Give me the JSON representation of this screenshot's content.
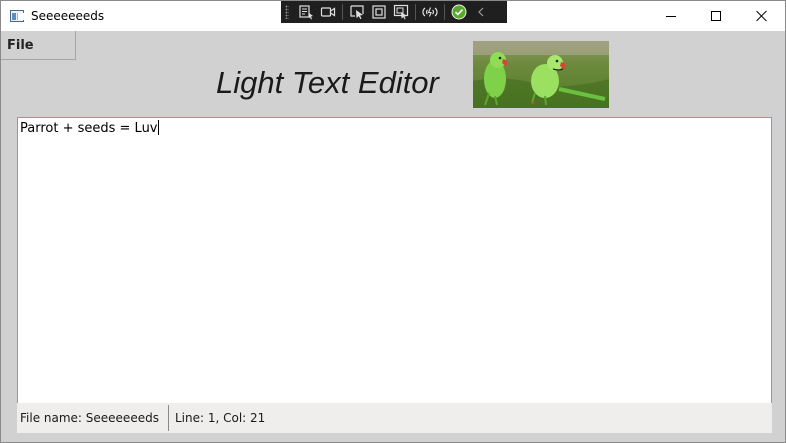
{
  "window": {
    "title": "Seeeeeeeds",
    "controls": {
      "minimize_icon": "minimize-icon",
      "maximize_icon": "maximize-icon",
      "close_icon": "close-icon"
    }
  },
  "debug_toolbar": {
    "icons": [
      "live-visual-tree-icon",
      "record-icon",
      "select-element-icon",
      "display-layout-adorners-icon",
      "track-focus-icon",
      "hot-reload-icon",
      "status-ok-icon",
      "collapse-chevron-icon"
    ],
    "colors": {
      "background": "#1f1f1f",
      "ok": "#4caf50"
    }
  },
  "menu": {
    "file_label": "File"
  },
  "header": {
    "title": "Light Text Editor",
    "image_icon": "parrots-photo"
  },
  "editor": {
    "text": "Parrot + seeds = Luv"
  },
  "status": {
    "file_name": "File name: Seeeeeeeds",
    "position": "Line: 1, Col: 21"
  },
  "colors": {
    "window_bg": "#d1d1d1",
    "editor_border": "#7a9ccc",
    "status_bg": "#f0eded"
  }
}
